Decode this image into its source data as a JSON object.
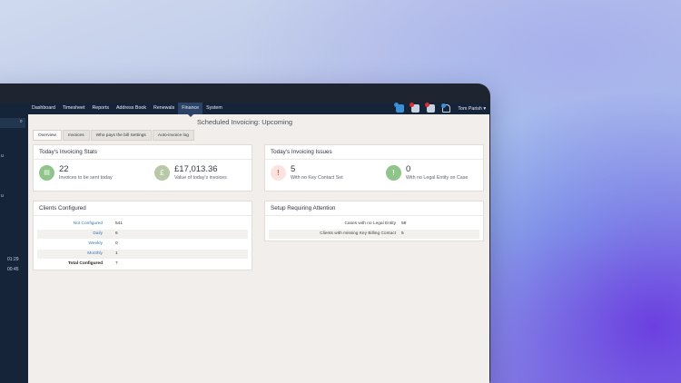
{
  "nav": {
    "items": [
      "Dashboard",
      "Timesheet",
      "Reports",
      "Address Book",
      "Renewals",
      "Finance",
      "System"
    ],
    "active": "Finance",
    "user": "Tom Parish ▾"
  },
  "sidebar": {
    "search_icon": "⌕",
    "letter": "u",
    "times": [
      "01:29",
      "00:45"
    ]
  },
  "page": {
    "title": "Scheduled Invoicing: Upcoming"
  },
  "tabs": [
    "Overview",
    "Invoices",
    "Who pays the bill Settings",
    "Auto-invoice log"
  ],
  "stats": {
    "heading": "Today's Invoicing Stats",
    "items": [
      {
        "value": "22",
        "label": "Invoices to be sent today",
        "icon": "document-icon",
        "color": "#8fc48a",
        "glyph": "▤"
      },
      {
        "value": "£17,013.36",
        "label": "Value of today's invoices",
        "icon": "pound-icon",
        "color": "#8fc48a",
        "glyph": "£"
      }
    ]
  },
  "issues": {
    "heading": "Today's Invoicing Issues",
    "items": [
      {
        "value": "5",
        "label": "With no Key Contact Set",
        "icon": "warning-icon",
        "color": "#e45a4a",
        "glyph": "!"
      },
      {
        "value": "0",
        "label": "With no Legal Entity on Case",
        "icon": "info-icon",
        "color": "#8fc48a",
        "glyph": "!"
      }
    ]
  },
  "clients": {
    "heading": "Clients Configured",
    "rows": [
      {
        "label": "Not Configured",
        "value": "541"
      },
      {
        "label": "Daily",
        "value": "6"
      },
      {
        "label": "Weekly",
        "value": "0"
      },
      {
        "label": "Monthly",
        "value": "1"
      },
      {
        "label": "Total Configured",
        "value": "7"
      }
    ]
  },
  "setup": {
    "heading": "Setup Requiring Attention",
    "rows": [
      {
        "label": "Cases with no Legal Entity",
        "value": "58"
      },
      {
        "label": "Clients with missing Key Billing Contact",
        "value": "5"
      }
    ]
  }
}
